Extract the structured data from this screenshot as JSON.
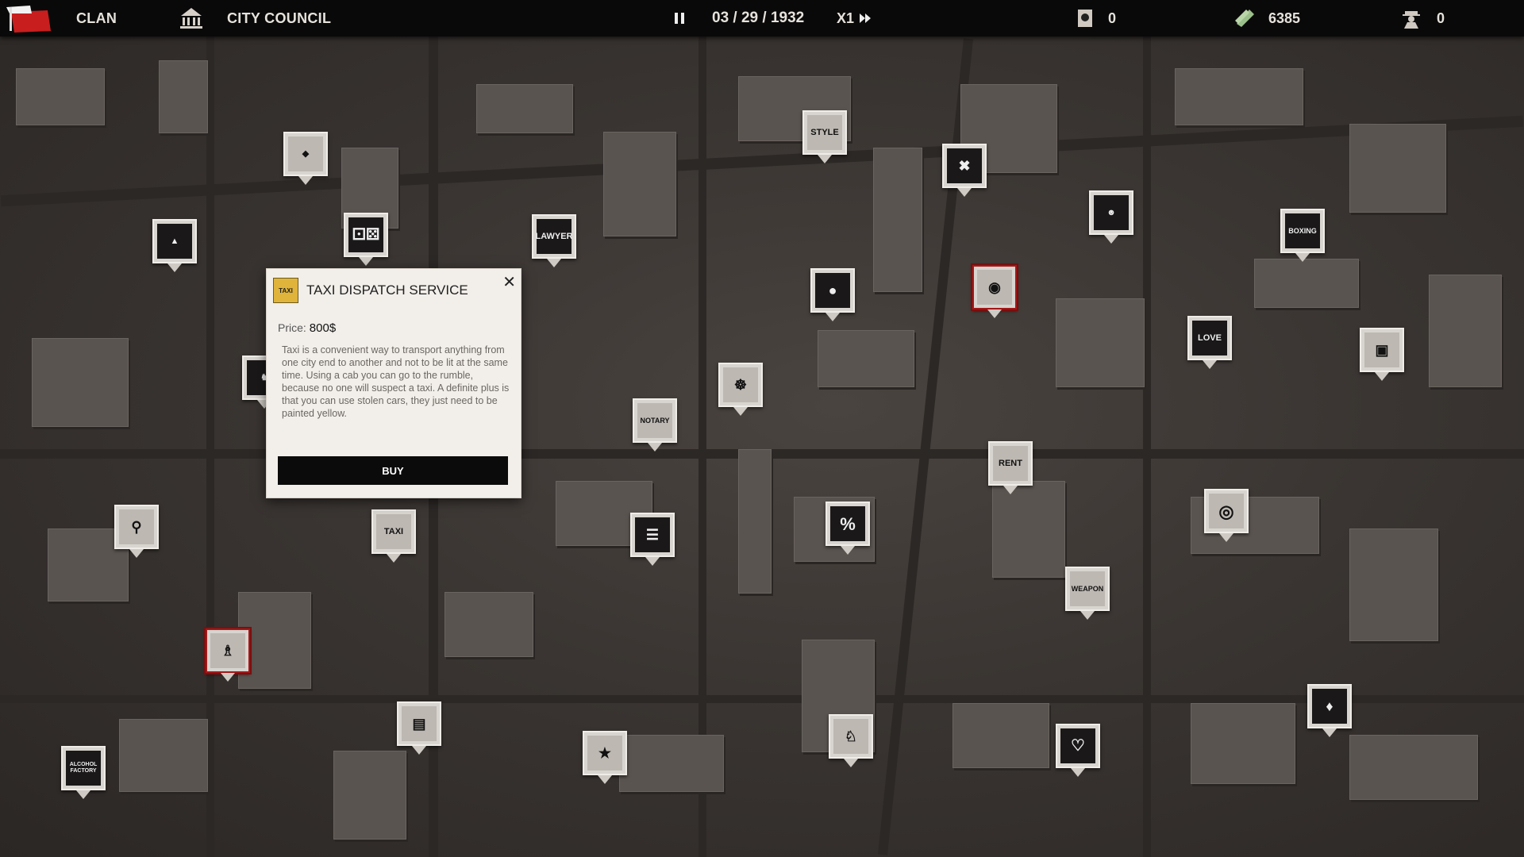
{
  "topbar": {
    "clan_label": "CLAN",
    "council_label": "CITY COUNCIL",
    "date": "03 / 29 / 1932",
    "speed": "X1",
    "reports_count": "0",
    "money": "6385",
    "henchmen_count": "0"
  },
  "popup": {
    "title": "TAXI DISPATCH SERVICE",
    "price_label": "Price:",
    "price_value": "800$",
    "description": "Taxi is a convenient way to transport anything from one city end to another and not to be lit at the same time. Using a cab you can go to the rumble, because no one will suspect a taxi. A definite plus is that you can use stolen cars, they just need to be painted yellow.",
    "buy_label": "BUY",
    "close_glyph": "✕",
    "icon_text": "TAXI"
  },
  "markers": {
    "style": "STYLE",
    "lawyer": "LAWYER",
    "notary": "NOTARY",
    "rent": "RENT",
    "taxi": "TAXI",
    "love": "LOVE",
    "percent": "%",
    "boxing": "BOXING",
    "weapon": "WEAPON",
    "alcohol": "ALCOHOL FACTORY"
  },
  "colors": {
    "topbar_bg": "#0a0909",
    "clan_flag": "#c81e1e",
    "money_icon": "#9bbf8a",
    "popup_bg": "#f2efea",
    "buy_bg": "#0b0b0b",
    "selected_border": "#a31818"
  }
}
